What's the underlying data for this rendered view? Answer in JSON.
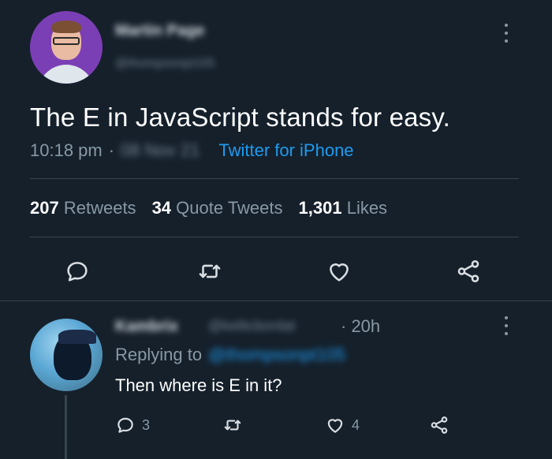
{
  "tweet": {
    "author_name": "Martin Page",
    "author_handle": "@thompsonpt105",
    "text": "The E in JavaScript stands for easy.",
    "time": "10:18 pm",
    "date": "08 Nov 21",
    "source": "Twitter for iPhone",
    "stats": {
      "retweets_count": "207",
      "retweets_label": "Retweets",
      "quotes_count": "34",
      "quotes_label": "Quote Tweets",
      "likes_count": "1,301",
      "likes_label": "Likes"
    },
    "icons": [
      "reply-icon",
      "retweet-icon",
      "like-icon",
      "share-icon"
    ]
  },
  "reply": {
    "author_name": "Kambrix",
    "author_handle": "@kelticbordat",
    "time": "· 20h",
    "replying_label": "Replying to",
    "replying_mention": "@thompsonpt105",
    "text": "Then where is E in it?",
    "reply_count": "3",
    "like_count": "4"
  },
  "colors": {
    "background": "#15202b",
    "text": "#ffffff",
    "secondary": "#8899a6",
    "accent": "#1d9bf0",
    "divider": "#38444d"
  }
}
